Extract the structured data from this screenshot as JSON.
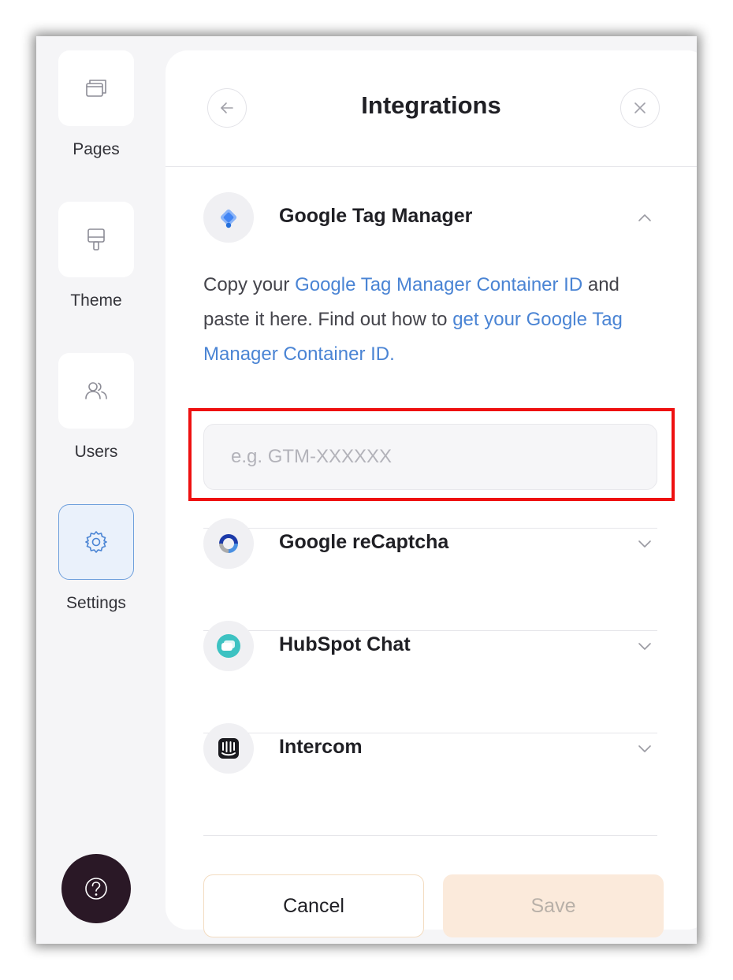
{
  "sidebar": {
    "items": [
      {
        "label": "Pages",
        "icon": "pages-icon"
      },
      {
        "label": "Theme",
        "icon": "paint-roller-icon"
      },
      {
        "label": "Users",
        "icon": "users-icon"
      },
      {
        "label": "Settings",
        "icon": "gear-icon",
        "active": true
      }
    ],
    "help_icon": "question-circle-icon"
  },
  "panel": {
    "title": "Integrations",
    "back_icon": "arrow-left-icon",
    "close_icon": "close-icon",
    "integrations": [
      {
        "name": "Google Tag Manager",
        "expanded": true,
        "description": {
          "t1": "Copy your ",
          "link1": "Google Tag Manager Container ID",
          "t2": " and paste it here. Find out how to ",
          "link2": "get your Google Tag Manager Container ID."
        },
        "input_value": "",
        "input_placeholder": "e.g. GTM-XXXXXX"
      },
      {
        "name": "Google reCaptcha",
        "expanded": false
      },
      {
        "name": "HubSpot Chat",
        "expanded": false
      },
      {
        "name": "Intercom",
        "expanded": false
      }
    ]
  },
  "footer": {
    "cancel_label": "Cancel",
    "save_label": "Save"
  },
  "colors": {
    "accent_link": "#4a84d4",
    "highlight_box": "#ee1111",
    "help_button": "#2a1826",
    "save_disabled_bg": "#fbeadb"
  }
}
